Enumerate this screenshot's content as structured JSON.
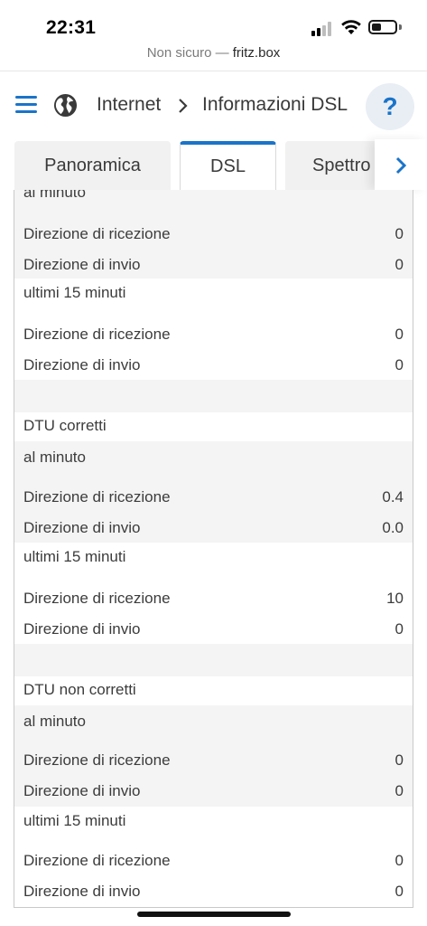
{
  "status": {
    "time": "22:31"
  },
  "browser": {
    "insecure_label": "Non sicuro — ",
    "host": "fritz.box"
  },
  "header": {
    "breadcrumb_root": "Internet",
    "breadcrumb_page": "Informazioni DSL",
    "help_label": "?"
  },
  "tabs": [
    {
      "label": "Panoramica"
    },
    {
      "label": "DSL"
    },
    {
      "label": "Spettro"
    }
  ],
  "sections": {
    "top": {
      "per_minute_label": "al minuto",
      "per_minute": [
        {
          "label": "Direzione di ricezione",
          "value": "0"
        },
        {
          "label": "Direzione di invio",
          "value": "0"
        }
      ],
      "last15_label": "ultimi 15 minuti",
      "last15": [
        {
          "label": "Direzione di ricezione",
          "value": "0"
        },
        {
          "label": "Direzione di invio",
          "value": "0"
        }
      ]
    },
    "corrected": {
      "title": "DTU corretti",
      "per_minute_label": "al minuto",
      "per_minute": [
        {
          "label": "Direzione di ricezione",
          "value": "0.4"
        },
        {
          "label": "Direzione di invio",
          "value": "0.0"
        }
      ],
      "last15_label": "ultimi 15 minuti",
      "last15": [
        {
          "label": "Direzione di ricezione",
          "value": "10"
        },
        {
          "label": "Direzione di invio",
          "value": "0"
        }
      ]
    },
    "uncorrected": {
      "title": "DTU non corretti",
      "per_minute_label": "al minuto",
      "per_minute": [
        {
          "label": "Direzione di ricezione",
          "value": "0"
        },
        {
          "label": "Direzione di invio",
          "value": "0"
        }
      ],
      "last15_label": "ultimi 15 minuti",
      "last15": [
        {
          "label": "Direzione di ricezione",
          "value": "0"
        },
        {
          "label": "Direzione di invio",
          "value": "0"
        }
      ]
    }
  },
  "colors": {
    "accent": "#1a74c9",
    "row_grey": "#f4f4f4"
  }
}
